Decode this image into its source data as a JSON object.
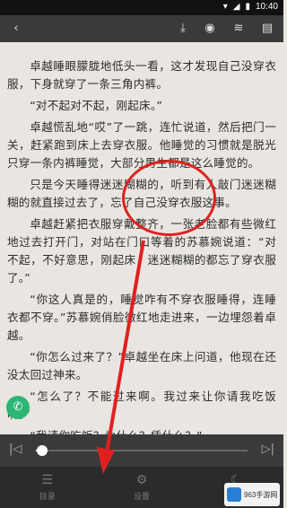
{
  "status_bar": {
    "time": "10:40"
  },
  "toolbar": {
    "back_icon": "back-arrow-icon",
    "download_icon": "download-icon",
    "audio_icon": "play-circle-icon",
    "mark_icon": "bookmark-icon",
    "chapter_icon": "book-icon"
  },
  "content": {
    "paragraphs": [
      "卓越睡眼朦胧地低头一看，这才发现自己没穿衣服，下身就穿了一条三角内裤。",
      "“对不起对不起，刚起床。”",
      "卓越慌乱地“哎”了一跳，连忙说道，然后把门一关，赶紧跑到床上去穿衣服。他睡觉的习惯就是脱光只穿一条内裤睡觉，大部分男生都是这么睡觉的。",
      "只是今天睡得迷迷糊糊的，听到有人敲门迷迷糊糊的就直接过去了，忘了自己没穿衣服这事。",
      "卓越赶紧把衣服穿戴整齐，一张老脸都有些微红地过去打开门，对站在门口等着的苏慕婉说道：“对不起，不好意思，刚起床，迷迷糊糊的都忘了穿衣服了。”",
      "“你这人真是的，睡觉咋有不穿衣服睡得，连睡衣都不穿。”苏慕婉俏脸微红地走进来，一边埋怨着卓越。",
      "“你怎么过来了？”卓越坐在床上问道，他现在还没太回过神来。",
      "“怎么了？不能过来啊。我过来让你请我吃饭啊。”",
      "“我请你吃饭？为什么？凭什么？”"
    ]
  },
  "floating": {
    "chat_icon": "chat-bubble-icon"
  },
  "progress": {
    "fraction": 0.03,
    "prev_icon": "skip-previous-icon",
    "next_icon": "skip-next-icon"
  },
  "bottom_nav": {
    "items": [
      {
        "label": "目录",
        "icon": "menu-list-icon"
      },
      {
        "label": "设置",
        "icon": "settings-icon"
      },
      {
        "label": "夜间",
        "icon": "night-mode-icon"
      }
    ]
  },
  "watermark": {
    "line1": "963手游网",
    "line2": ""
  },
  "colors": {
    "annotation_red": "#e02020",
    "toolbar_bg": "#3a3a3a",
    "page_bg": "#e9e6e1"
  }
}
